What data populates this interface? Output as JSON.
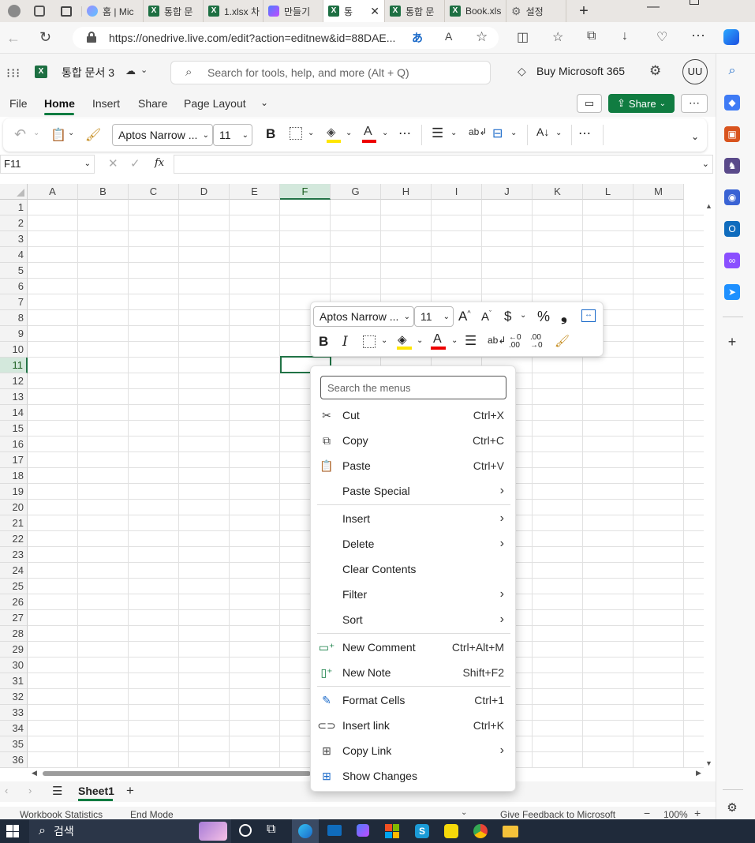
{
  "browser": {
    "tabs": [
      {
        "label": "홈 | Mic"
      },
      {
        "label": "통합 문"
      },
      {
        "label": "1.xlsx 차"
      },
      {
        "label": "만들기"
      },
      {
        "label": "통"
      },
      {
        "label": "통합 문"
      },
      {
        "label": "Book.xls"
      },
      {
        "label": "설정"
      }
    ],
    "url": "https://onedrive.live.com/edit?action=editnew&id=88DAE..."
  },
  "excel": {
    "doc_title": "통합 문서 3",
    "search_placeholder": "Search for tools, help, and more (Alt + Q)",
    "buy_label": "Buy Microsoft 365",
    "avatar": "UU",
    "menu": [
      "File",
      "Home",
      "Insert",
      "Share",
      "Page Layout"
    ],
    "share_label": "Share",
    "font_name": "Aptos Narrow ...",
    "font_size": "11",
    "name_box": "F11",
    "fx": "fx",
    "columns": [
      "A",
      "B",
      "C",
      "D",
      "E",
      "F",
      "G",
      "H",
      "I",
      "J",
      "K",
      "L",
      "M"
    ],
    "rows": [
      "1",
      "2",
      "3",
      "4",
      "5",
      "6",
      "7",
      "8",
      "9",
      "10",
      "11",
      "12",
      "13",
      "14",
      "15",
      "16",
      "17",
      "18",
      "19",
      "20",
      "21",
      "22",
      "23",
      "24",
      "25",
      "26",
      "27",
      "28",
      "29",
      "30",
      "31",
      "32",
      "33",
      "34",
      "35",
      "36"
    ],
    "sheet_tab": "Sheet1",
    "status": {
      "workbook_stats": "Workbook Statistics",
      "end_mode": "End Mode",
      "feedback": "Give Feedback to Microsoft",
      "zoom": "100%"
    }
  },
  "mini_toolbar": {
    "font_name": "Aptos Narrow ...",
    "font_size": "11"
  },
  "context_menu": {
    "search_placeholder": "Search the menus",
    "items": [
      {
        "label": "Cut",
        "shortcut": "Ctrl+X"
      },
      {
        "label": "Copy",
        "shortcut": "Ctrl+C"
      },
      {
        "label": "Paste",
        "shortcut": "Ctrl+V"
      },
      {
        "label": "Paste Special",
        "shortcut": ""
      },
      {
        "label": "Insert",
        "shortcut": ""
      },
      {
        "label": "Delete",
        "shortcut": ""
      },
      {
        "label": "Clear Contents",
        "shortcut": ""
      },
      {
        "label": "Filter",
        "shortcut": ""
      },
      {
        "label": "Sort",
        "shortcut": ""
      },
      {
        "label": "New Comment",
        "shortcut": "Ctrl+Alt+M"
      },
      {
        "label": "New Note",
        "shortcut": "Shift+F2"
      },
      {
        "label": "Format Cells",
        "shortcut": "Ctrl+1"
      },
      {
        "label": "Insert link",
        "shortcut": "Ctrl+K"
      },
      {
        "label": "Copy Link",
        "shortcut": ""
      },
      {
        "label": "Show Changes",
        "shortcut": ""
      }
    ]
  },
  "taskbar": {
    "search_label": "검색"
  },
  "colors": {
    "excel_green": "#1d6f42",
    "share_green": "#107c41",
    "selection_green": "#217346"
  }
}
